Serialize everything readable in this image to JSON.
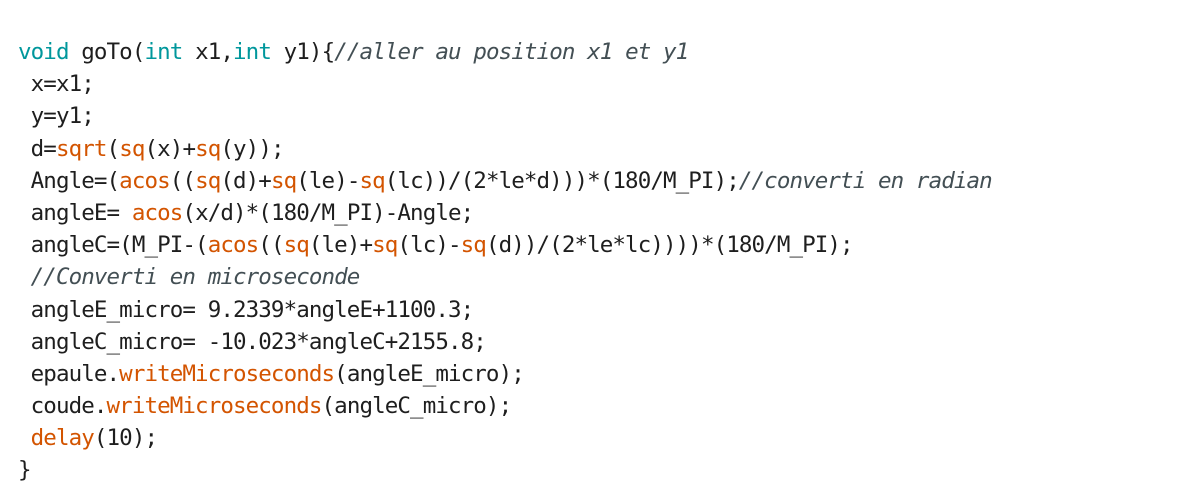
{
  "editor": {
    "colors": {
      "background": "#ffffff",
      "text": "#1e1e1e",
      "keyword": "#00979c",
      "function": "#d35400",
      "comment": "#434f54"
    },
    "lines": [
      {
        "tokens": [
          {
            "t": "void",
            "c": "kw"
          },
          {
            "t": " goTo(",
            "c": ""
          },
          {
            "t": "int",
            "c": "kw"
          },
          {
            "t": " x1,",
            "c": ""
          },
          {
            "t": "int",
            "c": "kw"
          },
          {
            "t": " y1){",
            "c": ""
          },
          {
            "t": "//aller au position x1 et y1",
            "c": "cm"
          }
        ]
      },
      {
        "tokens": [
          {
            "t": " x=x1;",
            "c": ""
          }
        ]
      },
      {
        "tokens": [
          {
            "t": " y=y1;",
            "c": ""
          }
        ]
      },
      {
        "tokens": [
          {
            "t": " d=",
            "c": ""
          },
          {
            "t": "sqrt",
            "c": "fn"
          },
          {
            "t": "(",
            "c": ""
          },
          {
            "t": "sq",
            "c": "fn"
          },
          {
            "t": "(x)+",
            "c": ""
          },
          {
            "t": "sq",
            "c": "fn"
          },
          {
            "t": "(y));",
            "c": ""
          }
        ]
      },
      {
        "tokens": [
          {
            "t": " Angle=(",
            "c": ""
          },
          {
            "t": "acos",
            "c": "fn"
          },
          {
            "t": "((",
            "c": ""
          },
          {
            "t": "sq",
            "c": "fn"
          },
          {
            "t": "(d)+",
            "c": ""
          },
          {
            "t": "sq",
            "c": "fn"
          },
          {
            "t": "(le)-",
            "c": ""
          },
          {
            "t": "sq",
            "c": "fn"
          },
          {
            "t": "(lc))/(2*le*d)))*(180/M_PI);",
            "c": ""
          },
          {
            "t": "//converti en radian",
            "c": "cm"
          }
        ]
      },
      {
        "tokens": [
          {
            "t": " angleE= ",
            "c": ""
          },
          {
            "t": "acos",
            "c": "fn"
          },
          {
            "t": "(x/d)*(180/M_PI)-Angle;",
            "c": ""
          }
        ]
      },
      {
        "tokens": [
          {
            "t": " angleC=(M_PI-(",
            "c": ""
          },
          {
            "t": "acos",
            "c": "fn"
          },
          {
            "t": "((",
            "c": ""
          },
          {
            "t": "sq",
            "c": "fn"
          },
          {
            "t": "(le)+",
            "c": ""
          },
          {
            "t": "sq",
            "c": "fn"
          },
          {
            "t": "(lc)-",
            "c": ""
          },
          {
            "t": "sq",
            "c": "fn"
          },
          {
            "t": "(d))/(2*le*lc))))*(180/M_PI);",
            "c": ""
          }
        ]
      },
      {
        "tokens": [
          {
            "t": " ",
            "c": ""
          },
          {
            "t": "//Converti en microseconde",
            "c": "cm"
          }
        ]
      },
      {
        "tokens": [
          {
            "t": " angleE_micro= 9.2339*angleE+1100.3;",
            "c": ""
          }
        ]
      },
      {
        "tokens": [
          {
            "t": " angleC_micro= -10.023*angleC+2155.8;",
            "c": ""
          }
        ]
      },
      {
        "tokens": [
          {
            "t": " epaule.",
            "c": ""
          },
          {
            "t": "writeMicroseconds",
            "c": "fn"
          },
          {
            "t": "(angleE_micro);",
            "c": ""
          }
        ]
      },
      {
        "tokens": [
          {
            "t": " coude.",
            "c": ""
          },
          {
            "t": "writeMicroseconds",
            "c": "fn"
          },
          {
            "t": "(angleC_micro);",
            "c": ""
          }
        ]
      },
      {
        "tokens": [
          {
            "t": " ",
            "c": ""
          },
          {
            "t": "delay",
            "c": "fn"
          },
          {
            "t": "(10);",
            "c": ""
          }
        ]
      },
      {
        "tokens": [
          {
            "t": "}",
            "c": ""
          }
        ]
      }
    ]
  }
}
